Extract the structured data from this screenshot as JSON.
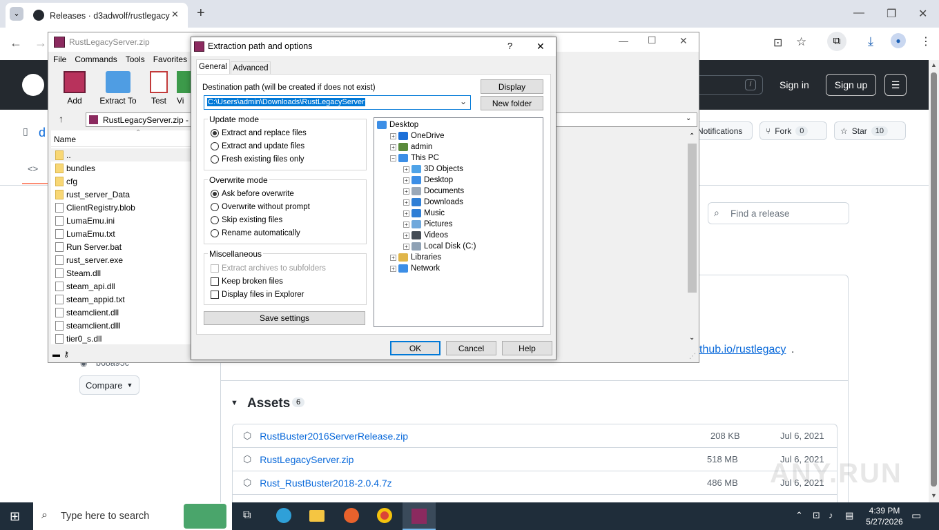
{
  "browser": {
    "tab_title": "Releases · d3adwolf/rustlegacy",
    "new_tab": "+",
    "minimize": "—",
    "restore": "❐",
    "close": "✕"
  },
  "github": {
    "sign_in": "Sign in",
    "sign_up": "Sign up",
    "slash": "/",
    "repo_short": "d",
    "notifications": "Notifications",
    "fork_label": "Fork",
    "fork_count": "0",
    "star_label": "Star",
    "star_count": "10",
    "find_release_placeholder": "Find a release",
    "link_text": "thub.io/rustlegacy",
    "link_suffix": ".",
    "commit_fragment": "b68a95c",
    "compare_label": "Compare",
    "assets_label": "Assets",
    "assets_count": "6",
    "assets": [
      {
        "name": "RustBuster2016ServerRelease.zip",
        "size": "208 KB",
        "date": "Jul 6, 2021"
      },
      {
        "name": "RustLegacyServer.zip",
        "size": "518 MB",
        "date": "Jul 6, 2021"
      },
      {
        "name": "Rust_RustBuster2018-2.0.4.7z",
        "size": "486 MB",
        "date": "Jul 6, 2021"
      }
    ]
  },
  "winrar": {
    "title": "RustLegacyServer.zip",
    "menu": [
      "File",
      "Commands",
      "Tools",
      "Favorites"
    ],
    "tools": [
      "Add",
      "Extract To",
      "Test",
      "Vi"
    ],
    "path": "RustLegacyServer.zip - Z",
    "column_name": "Name",
    "files": [
      {
        "name": "..",
        "type": "folder"
      },
      {
        "name": "bundles",
        "type": "folder"
      },
      {
        "name": "cfg",
        "type": "folder"
      },
      {
        "name": "rust_server_Data",
        "type": "folder"
      },
      {
        "name": "ClientRegistry.blob",
        "type": "file"
      },
      {
        "name": "LumaEmu.ini",
        "type": "file"
      },
      {
        "name": "LumaEmu.txt",
        "type": "file"
      },
      {
        "name": "Run Server.bat",
        "type": "file"
      },
      {
        "name": "rust_server.exe",
        "type": "file"
      },
      {
        "name": "Steam.dll",
        "type": "file"
      },
      {
        "name": "steam_api.dll",
        "type": "file"
      },
      {
        "name": "steam_appid.txt",
        "type": "file"
      },
      {
        "name": "steamclient.dll",
        "type": "file"
      },
      {
        "name": "steamclient.dlll",
        "type": "file"
      },
      {
        "name": "tier0_s.dll",
        "type": "file"
      }
    ]
  },
  "dialog": {
    "title": "Extraction path and options",
    "help_btn": "?",
    "close_btn": "✕",
    "tabs": [
      "General",
      "Advanced"
    ],
    "dest_label": "Destination path (will be created if does not exist)",
    "dest_value": "C:\\Users\\admin\\Downloads\\RustLegacyServer",
    "display_btn": "Display",
    "new_folder_btn": "New folder",
    "update_mode": {
      "title": "Update mode",
      "options": [
        "Extract and replace files",
        "Extract and update files",
        "Fresh existing files only"
      ],
      "selected": 0
    },
    "overwrite_mode": {
      "title": "Overwrite mode",
      "options": [
        "Ask before overwrite",
        "Overwrite without prompt",
        "Skip existing files",
        "Rename automatically"
      ],
      "selected": 0
    },
    "misc": {
      "title": "Miscellaneous",
      "options": [
        "Extract archives to subfolders",
        "Keep broken files",
        "Display files in Explorer"
      ]
    },
    "save_settings": "Save settings",
    "tree": [
      {
        "label": "Desktop",
        "level": 0,
        "pm": "",
        "color": "#3c8ee6"
      },
      {
        "label": "OneDrive",
        "level": 1,
        "pm": "+",
        "color": "#1b6fd8"
      },
      {
        "label": "admin",
        "level": 1,
        "pm": "+",
        "color": "#5a8a3c"
      },
      {
        "label": "This PC",
        "level": 1,
        "pm": "−",
        "color": "#3c8ee6"
      },
      {
        "label": "3D Objects",
        "level": 2,
        "pm": "+",
        "color": "#4fa3e8"
      },
      {
        "label": "Desktop",
        "level": 2,
        "pm": "+",
        "color": "#3c8ee6"
      },
      {
        "label": "Documents",
        "level": 2,
        "pm": "+",
        "color": "#9aa8b8"
      },
      {
        "label": "Downloads",
        "level": 2,
        "pm": "+",
        "color": "#2f7fd6"
      },
      {
        "label": "Music",
        "level": 2,
        "pm": "+",
        "color": "#2f7fd6"
      },
      {
        "label": "Pictures",
        "level": 2,
        "pm": "+",
        "color": "#6fa8dc"
      },
      {
        "label": "Videos",
        "level": 2,
        "pm": "+",
        "color": "#444c55"
      },
      {
        "label": "Local Disk (C:)",
        "level": 2,
        "pm": "+",
        "color": "#8fa2b5"
      },
      {
        "label": "Libraries",
        "level": 1,
        "pm": "+",
        "color": "#e0b64a"
      },
      {
        "label": "Network",
        "level": 1,
        "pm": "+",
        "color": "#3c8ee6"
      }
    ],
    "ok": "OK",
    "cancel": "Cancel",
    "help": "Help"
  },
  "taskbar": {
    "search_placeholder": "Type here to search",
    "time": "4:39 PM",
    "date": "5/27/2026"
  },
  "watermark": "ANY.RUN"
}
